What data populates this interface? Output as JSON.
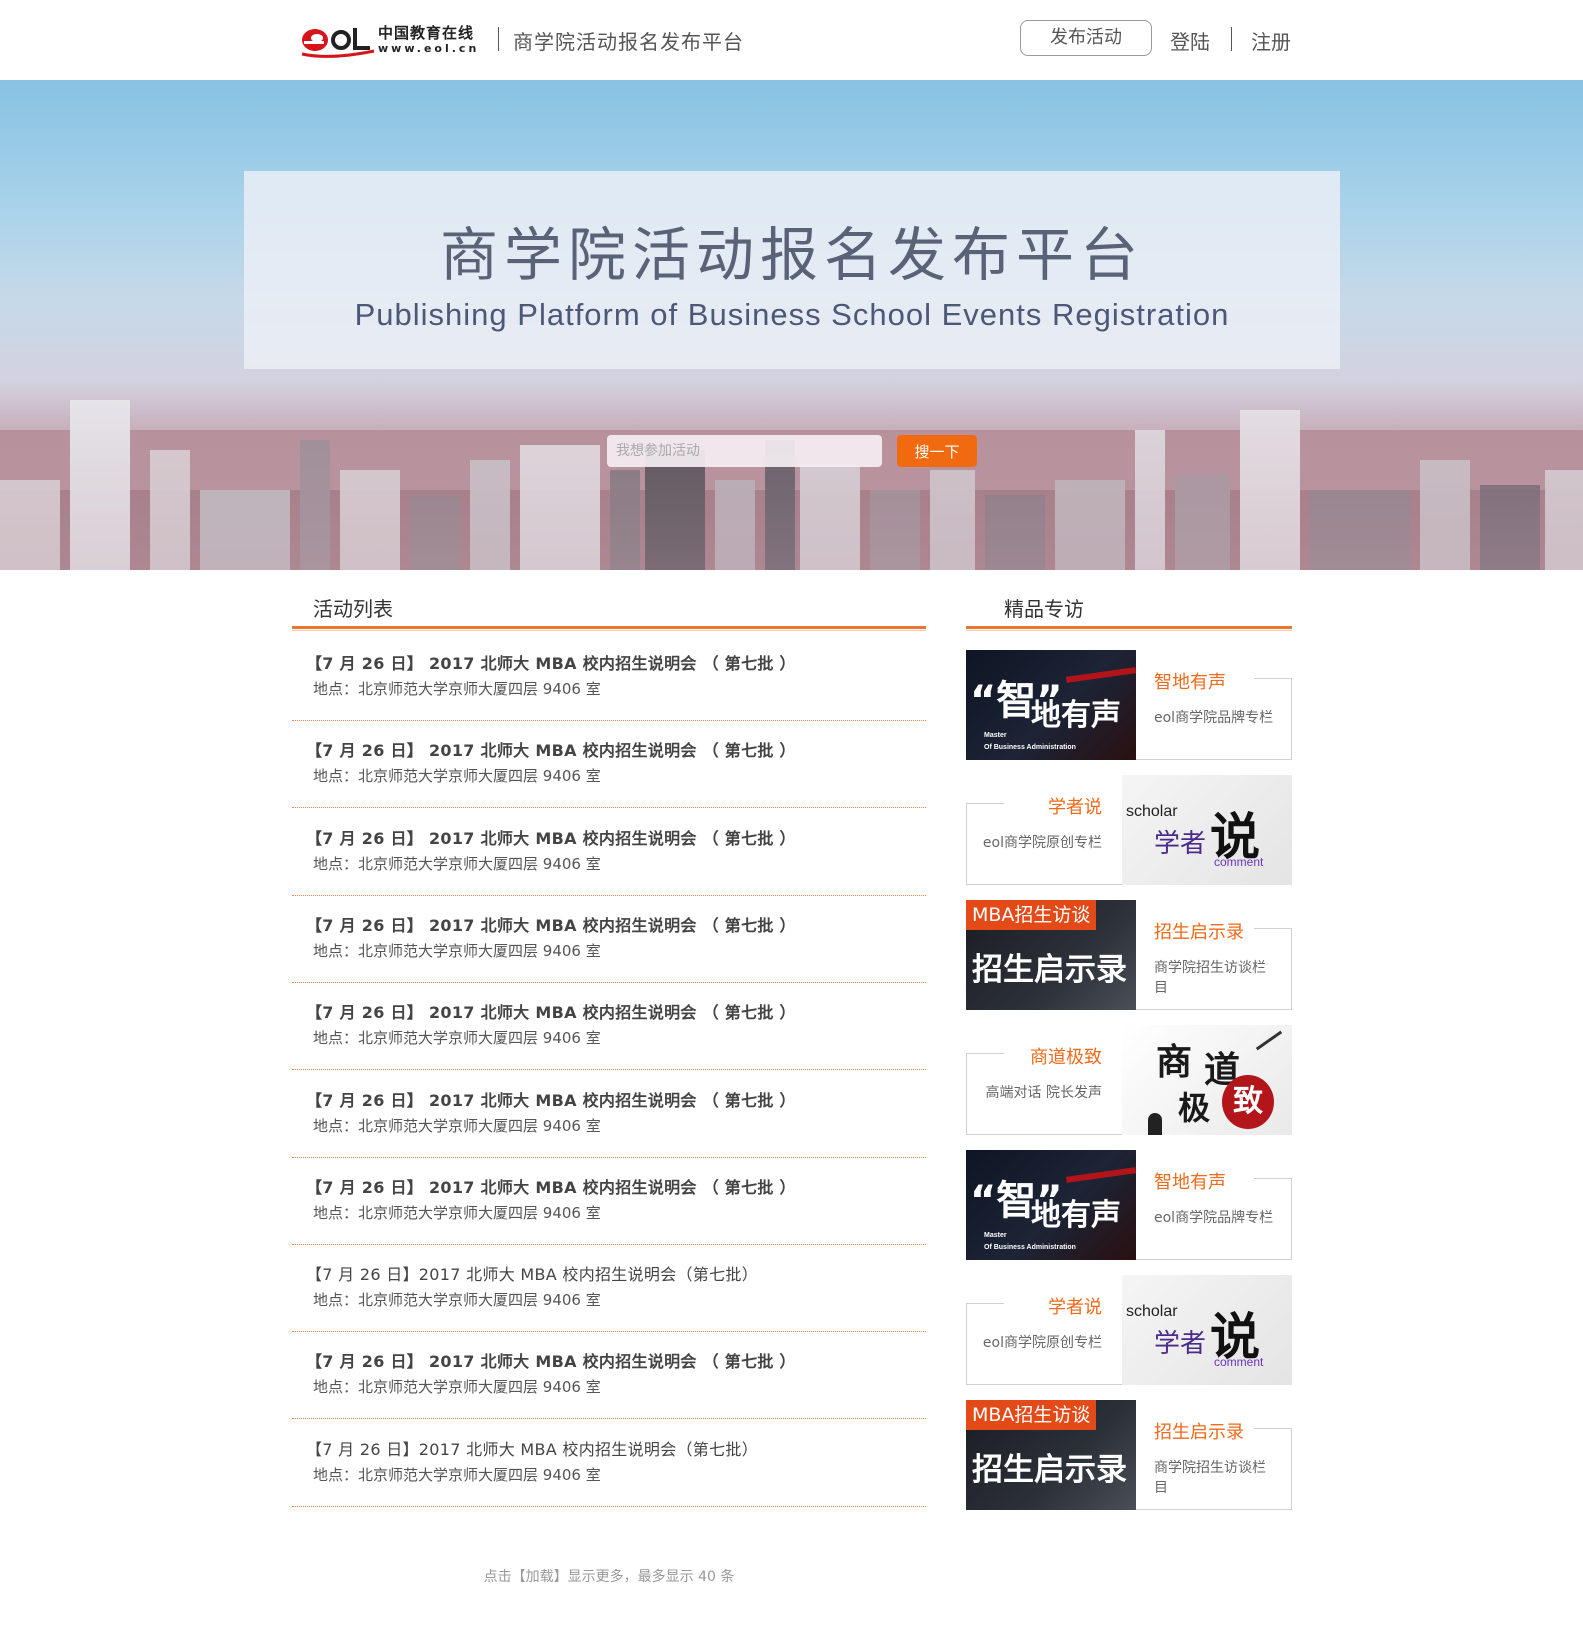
{
  "header": {
    "logo_cn": "中国教育在线",
    "logo_url": "www.eol.cn",
    "site_title": "商学院活动报名发布平台",
    "publish_label": "发布活动",
    "login_label": "登陆",
    "register_label": "注册"
  },
  "banner": {
    "title": "商学院活动报名发布平台",
    "subtitle": "Publishing Platform of Business School Events Registration",
    "search_placeholder": "我想参加活动",
    "search_button": "搜一下"
  },
  "activities": {
    "heading": "活动列表",
    "items": [
      {
        "title": "【7 月 26 日】 2017 北师大 MBA 校内招生说明会 （ 第七批 ）",
        "location": "地点：北京师范大学京师大厦四层 9406 室",
        "bold": true
      },
      {
        "title": "【7 月 26 日】 2017 北师大 MBA 校内招生说明会 （ 第七批 ）",
        "location": "地点：北京师范大学京师大厦四层 9406 室",
        "bold": true
      },
      {
        "title": "【7 月 26 日】 2017 北师大 MBA 校内招生说明会 （ 第七批 ）",
        "location": "地点：北京师范大学京师大厦四层 9406 室",
        "bold": true
      },
      {
        "title": "【7 月 26 日】 2017 北师大 MBA 校内招生说明会 （ 第七批 ）",
        "location": "地点：北京师范大学京师大厦四层 9406 室",
        "bold": true
      },
      {
        "title": "【7 月 26 日】 2017 北师大 MBA 校内招生说明会 （ 第七批 ）",
        "location": "地点：北京师范大学京师大厦四层 9406 室",
        "bold": true
      },
      {
        "title": "【7 月 26 日】 2017 北师大 MBA 校内招生说明会 （ 第七批 ）",
        "location": "地点：北京师范大学京师大厦四层 9406 室",
        "bold": true
      },
      {
        "title": "【7 月 26 日】 2017 北师大 MBA 校内招生说明会 （ 第七批 ）",
        "location": "地点：北京师范大学京师大厦四层 9406 室",
        "bold": true
      },
      {
        "title": "【7 月 26 日】2017 北师大 MBA 校内招生说明会（第七批）",
        "location": "地点：北京师范大学京师大厦四层 9406 室",
        "bold": false
      },
      {
        "title": "【7 月 26 日】 2017 北师大 MBA 校内招生说明会 （ 第七批 ）",
        "location": "地点：北京师范大学京师大厦四层 9406 室",
        "bold": true
      },
      {
        "title": "【7 月 26 日】2017 北师大 MBA 校内招生说明会（第七批）",
        "location": "地点：北京师范大学京师大厦四层 9406 室",
        "bold": false
      }
    ],
    "load_more": "点击【加载】显示更多，最多显示 40 条"
  },
  "interviews": {
    "heading": "精品专访",
    "cards": [
      {
        "name": "智地有声",
        "desc": "eol商学院品牌专栏",
        "image": "zhi",
        "img_side": "left"
      },
      {
        "name": "学者说",
        "desc": "eol商学院原创专栏",
        "image": "scholar",
        "img_side": "right"
      },
      {
        "name": "招生启示录",
        "desc": "商学院招生访谈栏目",
        "image": "mba",
        "img_side": "left"
      },
      {
        "name": "商道极致",
        "desc": "高端对话 院长发声",
        "image": "shang",
        "img_side": "right"
      },
      {
        "name": "智地有声",
        "desc": "eol商学院品牌专栏",
        "image": "zhi",
        "img_side": "left"
      },
      {
        "name": "学者说",
        "desc": "eol商学院原创专栏",
        "image": "scholar",
        "img_side": "right"
      },
      {
        "name": "招生启示录",
        "desc": "商学院招生访谈栏目",
        "image": "mba",
        "img_side": "left"
      }
    ],
    "image_text": {
      "zhi_big": "“智”",
      "zhi_big2": "地有声",
      "zhi_small_1": "Master",
      "zhi_small_2": "Of Business Administration",
      "scholar_en": "scholar",
      "scholar_cn": "学者",
      "scholar_shuo": "说",
      "scholar_comment": "comment",
      "mba_tag": "MBA招生访谈",
      "mba_big": "招生启示录",
      "shang_1": "商",
      "shang_2": "道",
      "shang_3": "极",
      "shang_seal": "致"
    }
  },
  "colors": {
    "accent": "#f26a0f",
    "title_orange": "#f06a1a",
    "divider": "#e8762e",
    "logo_red": "#d7141a"
  }
}
